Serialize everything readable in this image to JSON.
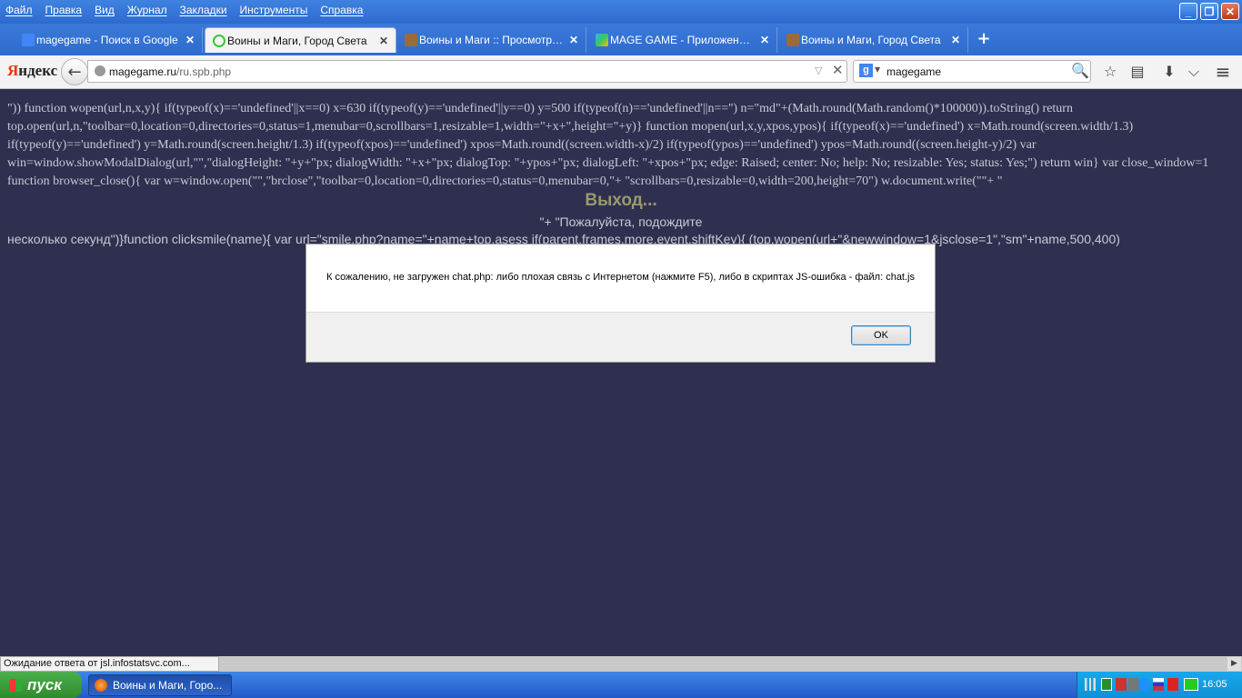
{
  "menu": [
    "Файл",
    "Правка",
    "Вид",
    "Журнал",
    "Закладки",
    "Инструменты",
    "Справка"
  ],
  "window_buttons": {
    "minimize": "_",
    "maximize": "❐",
    "close": "✕"
  },
  "tabs": [
    {
      "label": "magegame - Поиск в Google",
      "icon": "google-icon",
      "active": false
    },
    {
      "label": "Воины и Маги, Город Света",
      "icon": "loading-icon",
      "active": true
    },
    {
      "label": "Воины и Маги :: Просмотр т...",
      "icon": "game-icon",
      "active": false
    },
    {
      "label": "MAGE GAME - Приложения н...",
      "icon": "play-store-icon",
      "active": false
    },
    {
      "label": "Воины и Маги, Город Света",
      "icon": "game-icon",
      "active": false
    }
  ],
  "tab_close": "✕",
  "new_tab": "+",
  "navbar": {
    "yandex_first": "Я",
    "yandex_rest": "ндекс",
    "back": "←",
    "url_host": "magegame.ru",
    "url_path": "/ru.spb.php",
    "url_drop": "▽",
    "url_clear": "✕",
    "search_engine": "g",
    "search_drop": "▼",
    "search_value": "magegame",
    "search_icon": "🔍"
  },
  "toolbar_icons": {
    "star": "☆",
    "reading": "▤",
    "download": "⬇",
    "pocket": "⌵",
    "menu": "≡"
  },
  "page": {
    "code_text": "\")) function wopen(url,n,x,y){ if(typeof(x)=='undefined'||x==0) x=630 if(typeof(y)=='undefined'||y==0) y=500 if(typeof(n)=='undefined'||n=='') n=\"md\"+(Math.round(Math.random()*100000)).toString() return top.open(url,n,\"toolbar=0,location=0,directories=0,status=1,menubar=0,scrollbars=1,resizable=1,width=\"+x+\",height=\"+y)} function mopen(url,x,y,xpos,ypos){ if(typeof(x)=='undefined') x=Math.round(screen.width/1.3) if(typeof(y)=='undefined') y=Math.round(screen.height/1.3) if(typeof(xpos)=='undefined') xpos=Math.round((screen.width-x)/2) if(typeof(ypos)=='undefined') ypos=Math.round((screen.height-y)/2) var win=window.showModalDialog(url,\"\",\"dialogHeight: \"+y+\"px; dialogWidth: \"+x+\"px; dialogTop: \"+ypos+\"px; dialogLeft: \"+xpos+\"px; edge: Raised; center: No; help: No; resizable: Yes; status: Yes;\") return win} var close_window=1 function browser_close(){ var w=window.open(\"\",\"brclose\",\"toolbar=0,location=0,directories=0,status=0,menubar=0,\"+ \"scrollbars=0,resizable=0,width=200,height=70\") w.document.write(\"\"+ \"",
    "exit_text": "Выход...",
    "please_text": "\"+ \"Пожалуйста, подождите",
    "line3_text": "несколько секунд\")}function clicksmile(name){ var url=\"smile.php?name=\"+name+top.asess if(parent.frames.more.event.shiftKey){ (top.wopen(url+\"&newwindow=1&jsclose=1\",\"sm\"+name,500,400)"
  },
  "dialog": {
    "message": "К сожалению, не загружен chat.php: либо плохая связь с Интернетом (нажмите F5), либо в скриптах JS-ошибка - файл: chat.js",
    "ok_label": "OK"
  },
  "status": {
    "text": "Ожидание ответа от jsl.infostatsvc.com..."
  },
  "taskbar": {
    "start_label": "пуск",
    "task_label": "Воины и Маги, Горо...",
    "clock": "16:05"
  },
  "colors": {
    "page_bg": "#2f3050",
    "exit_text": "#9a9a6a",
    "titlebar": "#3a79d8"
  }
}
